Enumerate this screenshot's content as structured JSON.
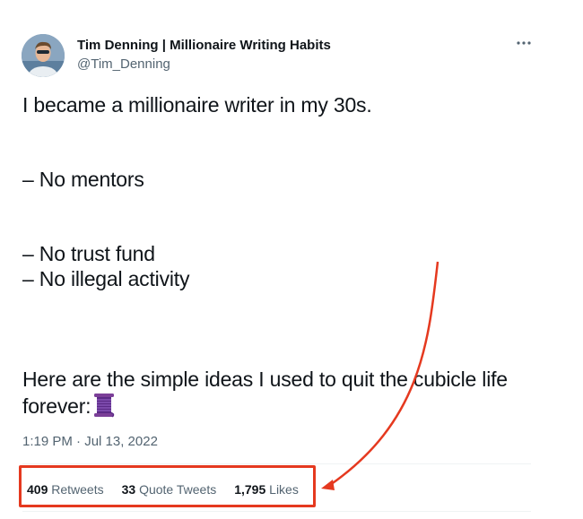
{
  "author": {
    "display_name": "Tim Denning | Millionaire Writing Habits",
    "handle": "@Tim_Denning",
    "avatar_icon": "profile-photo",
    "more_icon": "ellipsis-icon"
  },
  "tweet": {
    "lines": [
      "I became a millionaire writer in my 30s.",
      "– No mentors",
      "– No trust fund",
      "– No illegal activity",
      "Here are the simple ideas I used to quit the cubicle life",
      "forever:"
    ],
    "emoji": "thread-spool-emoji",
    "timestamp": "1:19 PM · Jul 13, 2022"
  },
  "stats": {
    "retweets_count": "409",
    "retweets_label": "Retweets",
    "quotes_count": "33",
    "quotes_label": "Quote Tweets",
    "likes_count": "1,795",
    "likes_label": "Likes"
  },
  "annotation": {
    "color": "#e5391f"
  }
}
